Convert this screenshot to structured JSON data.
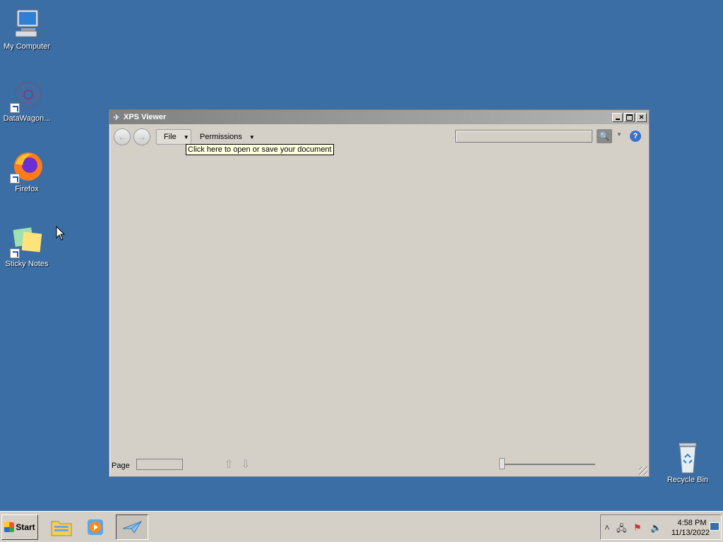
{
  "desktop": {
    "icons": [
      {
        "label": "My Computer"
      },
      {
        "label": "DataWagon..."
      },
      {
        "label": "Firefox"
      },
      {
        "label": "Sticky Notes"
      },
      {
        "label": "Recycle Bin"
      }
    ]
  },
  "window": {
    "title": "XPS Viewer",
    "toolbar": {
      "file_label": "File",
      "permissions_label": "Permissions",
      "help_label": "?"
    },
    "tooltip": "Click here to open or save your document",
    "status": {
      "page_label": "Page"
    }
  },
  "taskbar": {
    "start_label": "Start",
    "clock_time": "4:58 PM",
    "clock_date": "11/13/2022"
  },
  "colors": {
    "desktop": "#3a6ea5",
    "window_face": "#d4d0c8",
    "tooltip_bg": "#ffffe1"
  }
}
